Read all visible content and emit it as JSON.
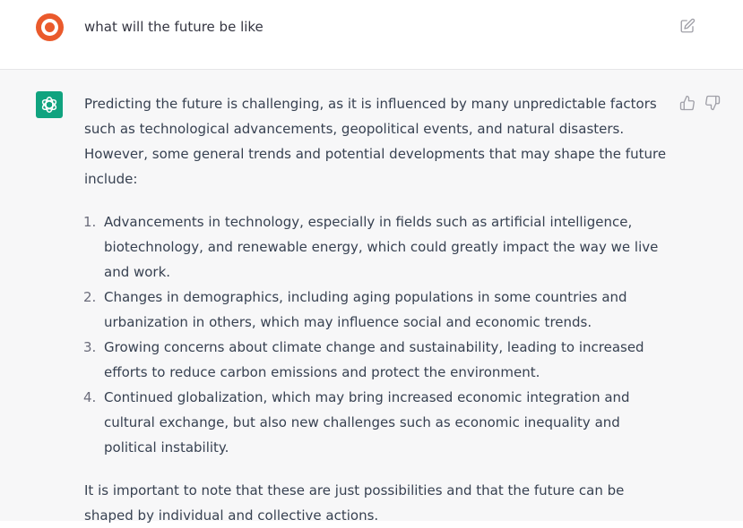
{
  "user_message": {
    "text": "what will the future be like"
  },
  "assistant_message": {
    "intro": "Predicting the future is challenging, as it is influenced by many unpredictable factors such as technological advancements, geopolitical events, and natural disasters. However, some general trends and potential developments that may shape the future include:",
    "items": [
      {
        "number": "1.",
        "text": "Advancements in technology, especially in fields such as artificial intelligence, biotechnology, and renewable energy, which could greatly impact the way we live and work."
      },
      {
        "number": "2.",
        "text": "Changes in demographics, including aging populations in some countries and urbanization in others, which may influence social and economic trends."
      },
      {
        "number": "3.",
        "text": "Growing concerns about climate change and sustainability, leading to increased efforts to reduce carbon emissions and protect the environment."
      },
      {
        "number": "4.",
        "text": "Continued globalization, which may bring increased economic integration and cultural exchange, but also new challenges such as economic inequality and political instability."
      }
    ],
    "conclusion": "It is important to note that these are just possibilities and that the future can be shaped by individual and collective actions."
  },
  "icons": {
    "user_avatar": "user-avatar-icon",
    "edit": "edit-icon",
    "assistant_avatar": "openai-logo-icon",
    "thumbs_up": "thumbs-up-icon",
    "thumbs_down": "thumbs-down-icon"
  },
  "colors": {
    "user_avatar": "#ea5a2c",
    "assistant_avatar": "#10a37f",
    "assistant_background": "#f7f7f8",
    "text": "#374151"
  }
}
